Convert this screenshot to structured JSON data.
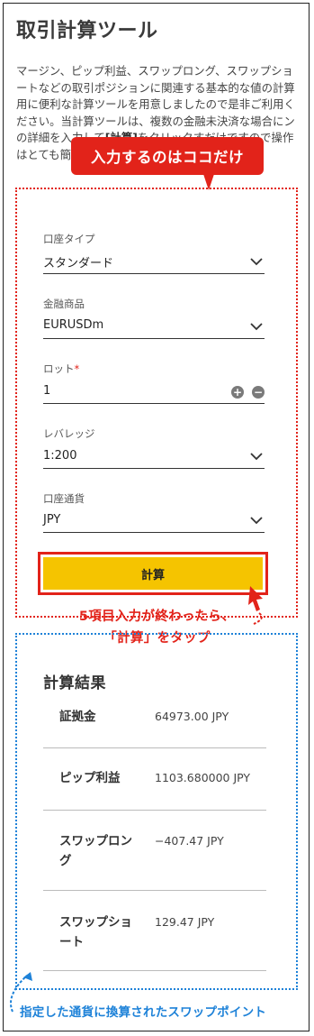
{
  "page": {
    "title": "取引計算ツール",
    "description_before": "マージン、ピップ利益、スワップロング、スワップショートなどの取引ポジションに関連する基本的な値の計算用に便利な計算ツールを用意しましたので是非ご利用ください。当計算ツールは、複数の金融",
    "description_hidden_gap": " ",
    "description_middle": "未決済な場合に",
    "description_middle2": "ンの詳細を入力して",
    "description_highlight": "[計算]",
    "description_middle3": "をクリックす",
    "description_after": "だけですので操作はとても簡単です。"
  },
  "callout": {
    "text": "入力するのはココだけ",
    "color": "#e2231a"
  },
  "form": {
    "account_type": {
      "label": "口座タイプ",
      "value": "スタンダード"
    },
    "instrument": {
      "label": "金融商品",
      "value": "EURUSDm"
    },
    "lot": {
      "label": "ロット",
      "required_mark": "*",
      "value": "1",
      "plus": "+",
      "minus": "−"
    },
    "leverage": {
      "label": "レバレッジ",
      "value": "1:200"
    },
    "currency": {
      "label": "口座通貨",
      "value": "JPY"
    },
    "calculate_label": "計算"
  },
  "notes": {
    "red_line1": "5項目入力が終わったら、",
    "red_line2": "「計算」をタップ",
    "blue_line": "指定した通貨に換算されたスワップポイント"
  },
  "results": {
    "title": "計算結果",
    "rows": [
      {
        "label": "証拠金",
        "value": "64973.00 JPY"
      },
      {
        "label": "ピップ利益",
        "value": "1103.680000 JPY"
      },
      {
        "label": "スワップロング",
        "value": "−407.47 JPY"
      },
      {
        "label": "スワップショート",
        "value": "129.47 JPY"
      }
    ]
  },
  "colors": {
    "accent_red": "#e2231a",
    "accent_blue": "#1e82d8",
    "button_yellow": "#f5c400"
  }
}
